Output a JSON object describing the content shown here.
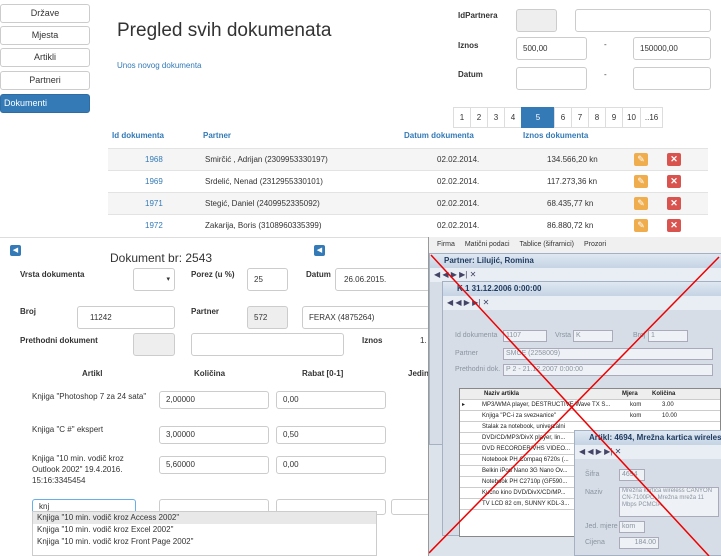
{
  "nav": [
    "Države",
    "Mjesta",
    "Artikli",
    "Partneri",
    "Dokumenti"
  ],
  "top": {
    "title": "Pregled svih dokumenata",
    "new_link": "Unos novog dokumenta",
    "idpartnera_label": "IdPartnera",
    "iznos_label": "Iznos",
    "datum_label": "Datum",
    "iznos_from": "500,00",
    "dash": "-",
    "iznos_to": "150000,00",
    "pages": [
      "1",
      "2",
      "3",
      "4",
      "5",
      "6",
      "7",
      "8",
      "9",
      "10",
      "..16"
    ],
    "cols": [
      "Id dokumenta",
      "Partner",
      "Datum dokumenta",
      "Iznos dokumenta"
    ],
    "rows": [
      {
        "id": "1968",
        "partner": "Smirčić , Adrijan (2309953330197)",
        "datum": "02.02.2014.",
        "iznos": "134.566,20 kn"
      },
      {
        "id": "1969",
        "partner": "Srdelić, Nenad (2312955330101)",
        "datum": "02.02.2014.",
        "iznos": "117.273,36 kn"
      },
      {
        "id": "1971",
        "partner": "Stegić, Daniel (2409952335092)",
        "datum": "02.02.2014.",
        "iznos": "68.435,77 kn"
      },
      {
        "id": "1972",
        "partner": "Zakarija, Boris (3108960335399)",
        "datum": "02.02.2014.",
        "iznos": "86.880,72 kn"
      }
    ]
  },
  "doc": {
    "title": "Dokument br: 2543",
    "vrsta": "Vrsta dokumenta",
    "porez": "Porez (u %)",
    "porez_val": "25",
    "datum": "Datum",
    "datum_val": "26.06.2015.",
    "broj": "Broj",
    "broj_val": "11242",
    "partner": "Partner",
    "partner_id": "572",
    "partner_val": "FERAX (4875264)",
    "prethodni": "Prethodni dokument",
    "iznos": "Iznos",
    "iznos_val": "1.",
    "cols": [
      "Artikl",
      "Količina",
      "Rabat [0-1]",
      "Jedin"
    ],
    "items": [
      {
        "artikl": "Knjiga \"Photoshop 7 za 24 sata\"",
        "kol": "2,00000",
        "rabat": "0,00"
      },
      {
        "artikl": "Knjiga \"C #\" ekspert",
        "kol": "3,00000",
        "rabat": "0,50"
      },
      {
        "artikl": "Knjiga \"10 min. vodič kroz Outlook 2002\" 19.4.2016. 15:16:3345454",
        "kol": "5,60000",
        "rabat": "0,00"
      }
    ],
    "search": "knj",
    "suggest": [
      "Knjiga \"10 min. vodič kroz Access 2002\"",
      "Knjiga \"10 min. vodič kroz Excel 2002\"",
      "Knjiga \"10 min. vodič kroz Front Page 2002\""
    ]
  },
  "win": {
    "menu": [
      "Firma",
      "Matični podaci",
      "Tablice (šifrarnici)",
      "Prozori"
    ],
    "w1": "Partner: Lilujić, Romina",
    "w2": "K 1 31.12.2006 0:00:00",
    "w2labels": [
      "Id dokumenta",
      "Vrsta",
      "Broj",
      "Partner",
      "Prethodni dok."
    ],
    "w2vals": [
      "1107",
      "K",
      "1",
      "SMCE (2258009)",
      "P 2 - 21.12.2007 0:00:00"
    ],
    "gridcols": [
      "Naziv artikla",
      "Mjera",
      "Količina"
    ],
    "gridrows": [
      "MP3/WMA player, DESTRUCTIVE Wave TX S...",
      "Knjiga \"PC-i za svezналice\"",
      "Stalak za notebook, univerzalni",
      "DVD/CD/MP3/DivX player, lin...",
      "DVD RECORDER/VHS VIDEO...",
      "Notebook PH Compaq 6720s (...",
      "Belkin iPod Nano 3G Nano Ov...",
      "Notebook PH C2710p (GF590...",
      "Kućno kino DVD/DivX/CD/MP...",
      "TV LCD 82 cm, SUNNY KDL-3..."
    ],
    "gridvals": [
      [
        "kom",
        "3.00"
      ],
      [
        "kom",
        "10.00"
      ]
    ],
    "w3": "Artikl: 4694, Mrežna kartica wireless",
    "w3labels": [
      "Šifra",
      "Naziv",
      "Jed. mjere",
      "Cijena"
    ],
    "w3vals": [
      "4694",
      "Mrežna kartica wireless CANYON CN-7100PC, Mrežna mreža 11 Mbps PCMCIA",
      "kom",
      "184.00"
    ]
  }
}
